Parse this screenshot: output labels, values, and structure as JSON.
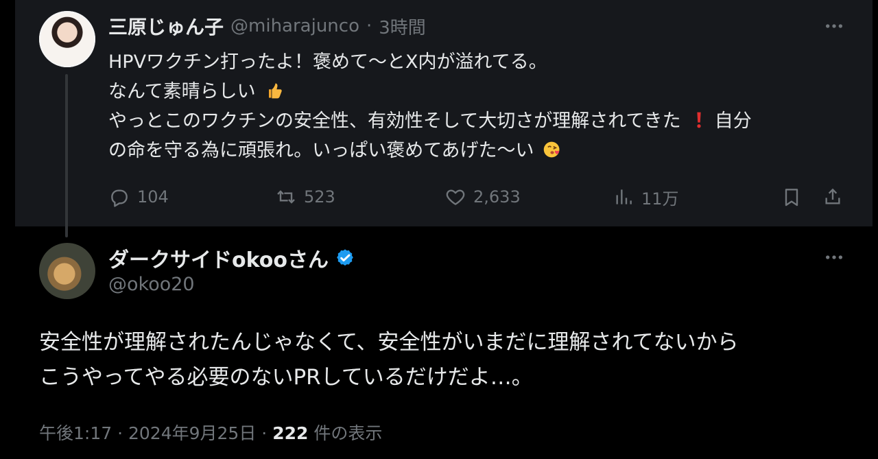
{
  "colors": {
    "background": "#000000",
    "parent_background": "#16181c",
    "primary_text": "#e7e9ea",
    "secondary_text": "#71767b",
    "verified_blue": "#1d9bf0"
  },
  "parent_tweet": {
    "display_name": "三原じゅん子",
    "handle": "@miharajunco",
    "separator": "·",
    "time": "3時間",
    "text_lines": [
      "HPVワクチン打ったよ！褒めて〜とX内が溢れてる。",
      "なんて素晴らしい",
      "やっとこのワクチンの安全性、有効性そして大切さが理解されてきた",
      "自分",
      "の命を守る為に頑張れ。いっぱい褒めてあげた〜い"
    ],
    "icons": {
      "avatar": "profile-avatar",
      "thumbs_up": "thumbs-up-emoji",
      "exclamation": "red-exclamation-emoji",
      "kiss": "face-blowing-kiss-emoji",
      "more": "more-dots-icon"
    },
    "actions": {
      "reply_count": "104",
      "retweet_count": "523",
      "like_count": "2,633",
      "views_count": "11万"
    }
  },
  "reply_tweet": {
    "display_name": "ダークサイドokooさん",
    "handle": "@okoo20",
    "verified": true,
    "text_lines": [
      "安全性が理解されたんじゃなくて、安全性がいまだに理解されてないから",
      "こうやってやる必要のないPRしているだけだよ…。"
    ],
    "meta": {
      "time": "午後1:17",
      "separator": "·",
      "date": "2024年9月25日",
      "views": "222",
      "views_label": "件の表示"
    },
    "icons": {
      "avatar": "cat-avatar",
      "verified": "verified-badge-icon",
      "more": "more-dots-icon"
    }
  }
}
